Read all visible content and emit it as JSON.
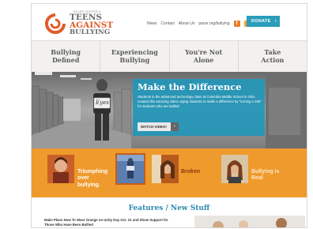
{
  "logo": {
    "small_text": "PACER CENTER'S",
    "line1": "TEENS",
    "line2": "AGAINST",
    "line3": "BULLYING"
  },
  "topnav": {
    "links": [
      "News",
      "Contact",
      "About Us",
      "pacer.org/bullying"
    ],
    "donate_label": "DONATE",
    "donate_arrow": "›"
  },
  "mainnav": {
    "items": [
      {
        "line1": "Bullying",
        "line2": "Defined"
      },
      {
        "line1": "Experiencing",
        "line2": "Bullying"
      },
      {
        "line1": "You're Not",
        "line2": "Alone"
      },
      {
        "line1": "Take",
        "line2": "Action"
      }
    ]
  },
  "hero": {
    "sign_text": "Eyes",
    "title": "Make the Difference",
    "body": "Students in the advanced technology class at Columbia Middle School in Ohio created this amazing video urging students to make a difference by \"turning a 180\" for students who are bullied.",
    "button_label": "WATCH VIDEO!",
    "button_arrow": "›"
  },
  "band": {
    "items": [
      {
        "line1": "Triumphing",
        "line2": "over",
        "line3": "bullying."
      },
      {
        "line1": "Broken"
      },
      {
        "line1": "Bullying is",
        "line2": "Real"
      }
    ]
  },
  "features": {
    "title": "Features / New Stuff",
    "text": "Make Plans Now To Wear Orange on Unity Day Oct. 21 and Show Support for Those Who Have Been Bullied"
  },
  "colors": {
    "brand_orange": "#e25d2a",
    "accent_blue": "#2a9dbb",
    "band_orange": "#ef9a2c",
    "features_blue": "#2d8ab0"
  }
}
